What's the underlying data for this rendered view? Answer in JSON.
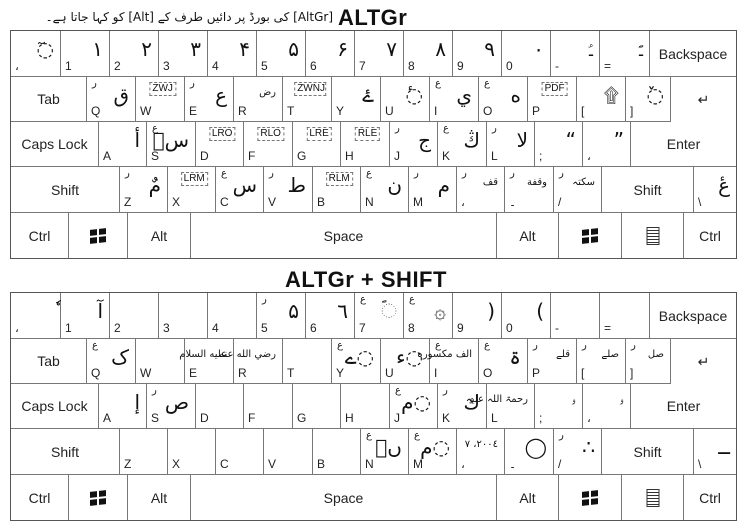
{
  "keyboards": [
    {
      "title": "ALTGr",
      "note": "[AltGr] کی بورڈ پر دائیں طرف کے [Alt] کو کہا جاتا ہے۔",
      "rows": [
        [
          {
            "l": "،",
            "g": "◌ٓ"
          },
          {
            "l": "1",
            "g": "۱"
          },
          {
            "l": "2",
            "g": "۲"
          },
          {
            "l": "3",
            "g": "۳"
          },
          {
            "l": "4",
            "g": "۴"
          },
          {
            "l": "5",
            "g": "۵"
          },
          {
            "l": "6",
            "g": "۶"
          },
          {
            "l": "7",
            "g": "۷"
          },
          {
            "l": "8",
            "g": "۸"
          },
          {
            "l": "9",
            "g": "۹"
          },
          {
            "l": "0",
            "g": "۰"
          },
          {
            "l": "-",
            "g": "ـؑ"
          },
          {
            "l": "=",
            "g": "ـؐ"
          },
          {
            "n": "Backspace"
          }
        ],
        [
          {
            "n": "Tab"
          },
          {
            "l": "Q",
            "s": "ر",
            "g": "ق"
          },
          {
            "l": "W",
            "b": "ZWJ"
          },
          {
            "l": "E",
            "s": "ر",
            "g": "ع"
          },
          {
            "l": "R",
            "g": "رض",
            "sg": true
          },
          {
            "l": "T",
            "b": "ZWNJ"
          },
          {
            "l": "Y",
            "g": "ۓ"
          },
          {
            "l": "U",
            "g": "◌ٔ"
          },
          {
            "l": "I",
            "s": "ع",
            "g": "ي"
          },
          {
            "l": "O",
            "s": "ع",
            "g": "ه"
          },
          {
            "l": "P",
            "b": "PDF"
          },
          {
            "l": "[",
            "g": "۩"
          },
          {
            "l": "]",
            "g": "◌ٚ"
          },
          {
            "n": "↵",
            "enter": true
          }
        ],
        [
          {
            "n": "Caps Lock"
          },
          {
            "l": "A",
            "g": "أ"
          },
          {
            "l": "S",
            "s": "ع",
            "g": "سؔ"
          },
          {
            "l": "D",
            "b": "LRO"
          },
          {
            "l": "F",
            "b": "RLO"
          },
          {
            "l": "G",
            "b": "LRE"
          },
          {
            "l": "H",
            "b": "RLE"
          },
          {
            "l": "J",
            "s": "ر",
            "g": "ج"
          },
          {
            "l": "K",
            "s": "ع",
            "g": "ڭ"
          },
          {
            "l": "L",
            "s": "ر",
            "g": "لا"
          },
          {
            "l": ";",
            "g": "“"
          },
          {
            "l": "،",
            "g": "”"
          },
          {
            "n": "Enter"
          }
        ],
        [
          {
            "n": "Shift"
          },
          {
            "l": "Z",
            "s": "ر",
            "g": "مٌ"
          },
          {
            "l": "X",
            "b": "LRM"
          },
          {
            "l": "C",
            "s": "ع",
            "g": "س"
          },
          {
            "l": "V",
            "s": "ر",
            "g": "ط"
          },
          {
            "l": "B",
            "b": "RLM"
          },
          {
            "l": "N",
            "s": "ع",
            "g": "ن"
          },
          {
            "l": "M",
            "s": "ر",
            "g": "م"
          },
          {
            "l": "،",
            "s": "ر",
            "g": "قف",
            "sg": true
          },
          {
            "l": "۔",
            "s": "ر",
            "g": "وقفة",
            "sg": true
          },
          {
            "l": "/",
            "s": "ر",
            "g": "سکتہ",
            "sg": true
          },
          {
            "n": "Shift"
          },
          {
            "l": "\\",
            "g": "عٔ"
          }
        ],
        [
          {
            "n": "Ctrl"
          },
          {
            "icon": "win"
          },
          {
            "n": "Alt"
          },
          {
            "n": "Space"
          },
          {
            "n": "Alt"
          },
          {
            "icon": "win"
          },
          {
            "icon": "menu"
          },
          {
            "n": "Ctrl"
          }
        ]
      ]
    },
    {
      "title": "ALTGr + SHIFT",
      "rows": [
        [
          {
            "l": "،",
            "g": "ٗ"
          },
          {
            "l": "1",
            "g": "آ"
          },
          {
            "l": "2"
          },
          {
            "l": "3"
          },
          {
            "l": "4"
          },
          {
            "l": "5",
            "s": "ر",
            "g": "۵"
          },
          {
            "l": "6",
            "g": "٦"
          },
          {
            "l": "7",
            "s": "ع",
            "g": "◌ؐ"
          },
          {
            "l": "8",
            "s": "ع",
            "g": "۞"
          },
          {
            "l": "9",
            "g": "("
          },
          {
            "l": "0",
            "g": ")"
          },
          {
            "l": "-"
          },
          {
            "l": "="
          },
          {
            "n": "Backspace"
          }
        ],
        [
          {
            "n": "Tab"
          },
          {
            "l": "Q",
            "s": "ع",
            "g": "ک"
          },
          {
            "l": "W"
          },
          {
            "l": "E",
            "g": "عليه السلام",
            "sg": true
          },
          {
            "l": "R",
            "g": "رضي الله عنه",
            "sg": true
          },
          {
            "l": "T"
          },
          {
            "l": "Y",
            "s": "ع",
            "g": "◌ے"
          },
          {
            "l": "U",
            "g": "◌ء"
          },
          {
            "l": "I",
            "s": "ع",
            "g": "الف مکسورہ",
            "sg": true
          },
          {
            "l": "O",
            "s": "ع",
            "g": "ۃ"
          },
          {
            "l": "P",
            "s": "ر",
            "g": "قلے",
            "sg": true
          },
          {
            "l": "[",
            "s": "ر",
            "g": "صلے",
            "sg": true
          },
          {
            "l": "]",
            "s": "ر",
            "g": "صل",
            "sg": true
          },
          {
            "n": "↵",
            "enter": true
          }
        ],
        [
          {
            "n": "Caps Lock"
          },
          {
            "l": "A",
            "g": "إ"
          },
          {
            "l": "S",
            "s": "ر",
            "g": "ص"
          },
          {
            "l": "D"
          },
          {
            "l": "F"
          },
          {
            "l": "G"
          },
          {
            "l": "H"
          },
          {
            "l": "J",
            "s": "ع",
            "g": "◌م"
          },
          {
            "l": "K",
            "s": "ر",
            "g": "ك"
          },
          {
            "l": "L",
            "g": "رحمۃ اللہ علیہ",
            "sg": true
          },
          {
            "l": ";",
            "g": "ۥ"
          },
          {
            "l": "،",
            "g": "ۥ"
          },
          {
            "n": "Enter"
          }
        ],
        [
          {
            "n": "Shift"
          },
          {
            "l": "Z"
          },
          {
            "l": "X"
          },
          {
            "l": "C"
          },
          {
            "l": "V"
          },
          {
            "l": "B"
          },
          {
            "l": "N",
            "s": "ع",
            "g": "ںؘ"
          },
          {
            "l": "M",
            "s": "ع",
            "g": "◌م"
          },
          {
            "l": "،",
            "g": "٢٠٠٤، ٧",
            "sg": true
          },
          {
            "l": "۔",
            "g": "◯"
          },
          {
            "l": "/",
            "s": "ر",
            "g": "∴"
          },
          {
            "n": "Shift"
          },
          {
            "l": "\\",
            "g": "ــ"
          }
        ],
        [
          {
            "n": "Ctrl"
          },
          {
            "icon": "win"
          },
          {
            "n": "Alt"
          },
          {
            "n": "Space"
          },
          {
            "n": "Alt"
          },
          {
            "icon": "win"
          },
          {
            "icon": "menu"
          },
          {
            "n": "Ctrl"
          }
        ]
      ]
    }
  ]
}
